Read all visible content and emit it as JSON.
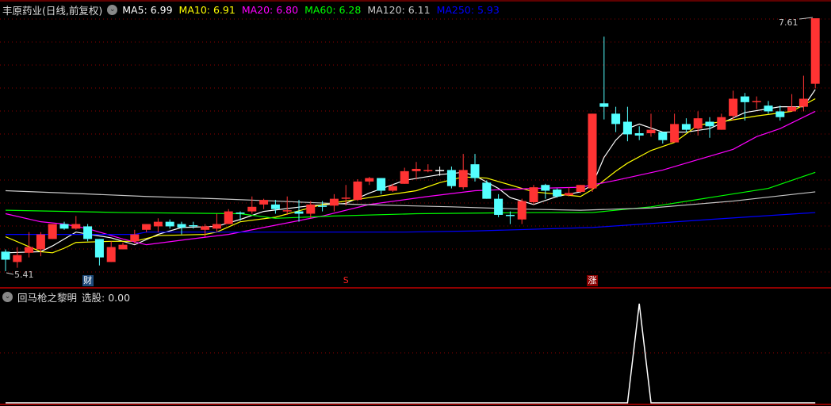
{
  "header": {
    "title": "丰原药业(日线,前复权)",
    "ma": [
      {
        "label": "MA5: 6.99",
        "color": "#ffffff"
      },
      {
        "label": "MA10: 6.91",
        "color": "#ffff00"
      },
      {
        "label": "MA20: 6.80",
        "color": "#ff00ff"
      },
      {
        "label": "MA60: 6.28",
        "color": "#00ff00"
      },
      {
        "label": "MA120: 6.11",
        "color": "#c8c8c8"
      },
      {
        "label": "MA250: 5.93",
        "color": "#0000ff"
      }
    ]
  },
  "price_labels": {
    "high": "7.61",
    "low": "5.41"
  },
  "markers": [
    {
      "text": "财",
      "index": 7,
      "bg": "#1e4a7a",
      "color": "#ffffff"
    },
    {
      "text": "S",
      "index": 29,
      "bg": "transparent",
      "color": "#ff2020"
    },
    {
      "text": "涨",
      "index": 50,
      "bg": "#8b0000",
      "color": "#ffffff"
    }
  ],
  "indicator": {
    "name": "回马枪之黎明",
    "value_label": "选股: 0.00",
    "signal_index": 54,
    "signal_value": 1
  },
  "colors": {
    "up": "#ff3333",
    "down": "#54ffff",
    "grid": "#8b0000",
    "border": "#c00000"
  },
  "chart_data": {
    "type": "candlestick",
    "ylim": [
      5.41,
      7.61
    ],
    "candles_ohlc": [
      [
        5.58,
        5.6,
        5.41,
        5.51
      ],
      [
        5.49,
        5.62,
        5.44,
        5.55
      ],
      [
        5.57,
        5.75,
        5.53,
        5.62
      ],
      [
        5.6,
        5.75,
        5.54,
        5.73
      ],
      [
        5.69,
        5.82,
        5.69,
        5.82
      ],
      [
        5.82,
        5.84,
        5.77,
        5.78
      ],
      [
        5.78,
        5.89,
        5.77,
        5.82
      ],
      [
        5.8,
        5.82,
        5.67,
        5.69
      ],
      [
        5.69,
        5.69,
        5.46,
        5.53
      ],
      [
        5.49,
        5.67,
        5.49,
        5.62
      ],
      [
        5.6,
        5.66,
        5.6,
        5.64
      ],
      [
        5.67,
        5.77,
        5.65,
        5.73
      ],
      [
        5.77,
        5.82,
        5.75,
        5.82
      ],
      [
        5.8,
        5.87,
        5.75,
        5.84
      ],
      [
        5.84,
        5.86,
        5.78,
        5.8
      ],
      [
        5.82,
        5.84,
        5.73,
        5.79
      ],
      [
        5.81,
        5.84,
        5.78,
        5.8
      ],
      [
        5.77,
        5.82,
        5.71,
        5.8
      ],
      [
        5.78,
        5.91,
        5.75,
        5.82
      ],
      [
        5.82,
        5.95,
        5.82,
        5.93
      ],
      [
        5.92,
        5.93,
        5.85,
        5.91
      ],
      [
        5.93,
        6.06,
        5.91,
        5.97
      ],
      [
        5.99,
        6.04,
        5.95,
        6.03
      ],
      [
        5.99,
        6.03,
        5.91,
        5.95
      ],
      [
        5.93,
        6.06,
        5.9,
        5.94
      ],
      [
        5.93,
        6.03,
        5.84,
        5.91
      ],
      [
        5.91,
        6.02,
        5.87,
        5.99
      ],
      [
        5.98,
        6.02,
        5.93,
        5.97
      ],
      [
        5.98,
        6.08,
        5.93,
        6.04
      ],
      [
        6.04,
        6.16,
        5.98,
        6.05
      ],
      [
        6.03,
        6.21,
        6.02,
        6.19
      ],
      [
        6.19,
        6.23,
        6.16,
        6.22
      ],
      [
        6.22,
        6.22,
        6.08,
        6.11
      ],
      [
        6.11,
        6.17,
        6.1,
        6.15
      ],
      [
        6.17,
        6.31,
        6.17,
        6.28
      ],
      [
        6.28,
        6.36,
        6.21,
        6.3
      ],
      [
        6.28,
        6.34,
        6.27,
        6.29
      ],
      [
        6.29,
        6.32,
        6.24,
        6.29
      ],
      [
        6.29,
        6.32,
        6.13,
        6.15
      ],
      [
        6.14,
        6.43,
        6.12,
        6.29
      ],
      [
        6.34,
        6.43,
        6.19,
        6.22
      ],
      [
        6.18,
        6.2,
        6.04,
        6.04
      ],
      [
        6.04,
        6.08,
        5.88,
        5.9
      ],
      [
        5.9,
        5.93,
        5.82,
        5.89
      ],
      [
        5.86,
        6.04,
        5.82,
        6.02
      ],
      [
        6.01,
        6.16,
        5.99,
        6.14
      ],
      [
        6.16,
        6.17,
        6.04,
        6.11
      ],
      [
        6.12,
        6.13,
        6.05,
        6.06
      ],
      [
        6.07,
        6.14,
        6.06,
        6.09
      ],
      [
        6.1,
        6.16,
        6.09,
        6.16
      ],
      [
        6.13,
        6.78,
        6.1,
        6.78
      ],
      [
        6.87,
        7.45,
        6.73,
        6.84
      ],
      [
        6.78,
        6.84,
        6.62,
        6.69
      ],
      [
        6.71,
        6.84,
        6.54,
        6.6
      ],
      [
        6.61,
        6.67,
        6.55,
        6.59
      ],
      [
        6.61,
        6.78,
        6.58,
        6.64
      ],
      [
        6.62,
        6.62,
        6.52,
        6.55
      ],
      [
        6.53,
        6.78,
        6.53,
        6.69
      ],
      [
        6.69,
        6.74,
        6.62,
        6.64
      ],
      [
        6.65,
        6.8,
        6.59,
        6.74
      ],
      [
        6.71,
        6.75,
        6.57,
        6.67
      ],
      [
        6.64,
        6.78,
        6.64,
        6.75
      ],
      [
        6.76,
        6.98,
        6.72,
        6.91
      ],
      [
        6.93,
        6.96,
        6.72,
        6.88
      ],
      [
        6.88,
        6.93,
        6.82,
        6.89
      ],
      [
        6.85,
        6.89,
        6.78,
        6.8
      ],
      [
        6.8,
        6.85,
        6.72,
        6.75
      ],
      [
        6.8,
        6.95,
        6.8,
        6.84
      ],
      [
        6.84,
        7.11,
        6.8,
        6.91
      ],
      [
        7.04,
        7.61,
        7.0,
        7.61
      ]
    ],
    "ma_series": [
      {
        "name": "MA5",
        "color": "#ffffff",
        "points": [
          [
            0,
            5.57
          ],
          [
            3,
            5.58
          ],
          [
            4,
            5.63
          ],
          [
            6,
            5.75
          ],
          [
            9,
            5.7
          ],
          [
            11,
            5.64
          ],
          [
            13,
            5.73
          ],
          [
            15,
            5.79
          ],
          [
            18,
            5.8
          ],
          [
            20,
            5.86
          ],
          [
            22,
            5.93
          ],
          [
            26,
            5.98
          ],
          [
            29,
            6.0
          ],
          [
            31,
            6.09
          ],
          [
            34,
            6.2
          ],
          [
            37,
            6.25
          ],
          [
            39,
            6.27
          ],
          [
            40,
            6.24
          ],
          [
            42,
            6.13
          ],
          [
            43,
            6.05
          ],
          [
            45,
            5.99
          ],
          [
            47,
            6.06
          ],
          [
            49,
            6.1
          ],
          [
            50,
            6.16
          ],
          [
            51,
            6.4
          ],
          [
            52,
            6.55
          ],
          [
            53,
            6.65
          ],
          [
            54,
            6.69
          ],
          [
            56,
            6.62
          ],
          [
            58,
            6.62
          ],
          [
            60,
            6.65
          ],
          [
            63,
            6.79
          ],
          [
            66,
            6.84
          ],
          [
            68,
            6.84
          ],
          [
            69,
            6.99
          ]
        ]
      },
      {
        "name": "MA10",
        "color": "#ffff00",
        "points": [
          [
            0,
            5.71
          ],
          [
            3,
            5.58
          ],
          [
            4,
            5.57
          ],
          [
            5,
            5.61
          ],
          [
            6,
            5.66
          ],
          [
            9,
            5.67
          ],
          [
            11,
            5.67
          ],
          [
            13,
            5.72
          ],
          [
            17,
            5.73
          ],
          [
            18,
            5.75
          ],
          [
            20,
            5.84
          ],
          [
            23,
            5.88
          ],
          [
            27,
            5.99
          ],
          [
            31,
            6.05
          ],
          [
            35,
            6.11
          ],
          [
            37,
            6.18
          ],
          [
            39,
            6.23
          ],
          [
            41,
            6.22
          ],
          [
            43,
            6.16
          ],
          [
            45,
            6.1
          ],
          [
            47,
            6.08
          ],
          [
            49,
            6.06
          ],
          [
            50,
            6.12
          ],
          [
            51,
            6.2
          ],
          [
            52,
            6.28
          ],
          [
            53,
            6.35
          ],
          [
            55,
            6.46
          ],
          [
            57,
            6.53
          ],
          [
            59,
            6.68
          ],
          [
            61,
            6.71
          ],
          [
            64,
            6.76
          ],
          [
            67,
            6.8
          ],
          [
            69,
            6.91
          ]
        ]
      },
      {
        "name": "MA20",
        "color": "#ff00ff",
        "points": [
          [
            0,
            5.91
          ],
          [
            3,
            5.84
          ],
          [
            5,
            5.82
          ],
          [
            7,
            5.78
          ],
          [
            10,
            5.69
          ],
          [
            12,
            5.64
          ],
          [
            15,
            5.68
          ],
          [
            19,
            5.73
          ],
          [
            22,
            5.79
          ],
          [
            27,
            5.89
          ],
          [
            31,
            5.99
          ],
          [
            36,
            6.06
          ],
          [
            40,
            6.11
          ],
          [
            45,
            6.13
          ],
          [
            49,
            6.14
          ],
          [
            52,
            6.2
          ],
          [
            56,
            6.29
          ],
          [
            59,
            6.38
          ],
          [
            62,
            6.47
          ],
          [
            64,
            6.58
          ],
          [
            66,
            6.65
          ],
          [
            69,
            6.8
          ]
        ]
      },
      {
        "name": "MA60",
        "color": "#00ff00",
        "points": [
          [
            0,
            5.94
          ],
          [
            10,
            5.92
          ],
          [
            20,
            5.91
          ],
          [
            23,
            5.87
          ],
          [
            28,
            5.89
          ],
          [
            35,
            5.91
          ],
          [
            45,
            5.92
          ],
          [
            50,
            5.92
          ],
          [
            55,
            5.97
          ],
          [
            60,
            6.05
          ],
          [
            65,
            6.13
          ],
          [
            69,
            6.27
          ]
        ]
      },
      {
        "name": "MA120",
        "color": "#c8c8c8",
        "points": [
          [
            0,
            6.11
          ],
          [
            5,
            6.09
          ],
          [
            12,
            6.06
          ],
          [
            18,
            6.04
          ],
          [
            23,
            6.02
          ],
          [
            30,
            5.99
          ],
          [
            38,
            5.97
          ],
          [
            44,
            5.95
          ],
          [
            49,
            5.94
          ],
          [
            55,
            5.96
          ],
          [
            62,
            6.02
          ],
          [
            69,
            6.1
          ]
        ]
      },
      {
        "name": "MA250",
        "color": "#0000ff",
        "points": [
          [
            0,
            5.73
          ],
          [
            11,
            5.73
          ],
          [
            12,
            5.75
          ],
          [
            34,
            5.75
          ],
          [
            40,
            5.76
          ],
          [
            50,
            5.79
          ],
          [
            60,
            5.86
          ],
          [
            69,
            5.92
          ]
        ]
      }
    ]
  }
}
